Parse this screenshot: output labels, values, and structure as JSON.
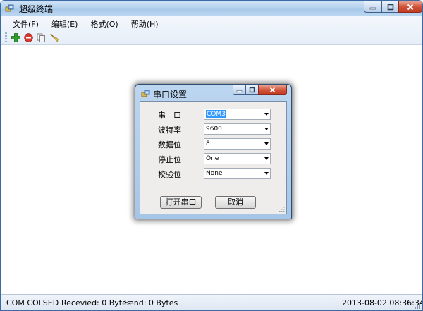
{
  "window": {
    "title": "超级终端"
  },
  "menu": [
    {
      "id": "file",
      "label": "文件(F)"
    },
    {
      "id": "edit",
      "label": "编辑(E)"
    },
    {
      "id": "format",
      "label": "格式(O)"
    },
    {
      "id": "help",
      "label": "帮助(H)"
    }
  ],
  "toolbar": [
    {
      "id": "add",
      "icon": "plus-icon"
    },
    {
      "id": "stop",
      "icon": "stop-icon"
    },
    {
      "id": "copy",
      "icon": "copy-icon"
    },
    {
      "id": "clear",
      "icon": "broom-icon"
    }
  ],
  "status": {
    "port_state": "COM COLSED",
    "received": "Recevied: 0 Bytes",
    "sent": "Send: 0 Bytes",
    "timestamp": "2013-08-02 08:36:34"
  },
  "dialog": {
    "title": "串口设置",
    "fields": [
      {
        "id": "port",
        "label": "串　口",
        "value": "COM3",
        "selected": true
      },
      {
        "id": "baud",
        "label": "波特率",
        "value": "9600",
        "selected": false
      },
      {
        "id": "databits",
        "label": "数据位",
        "value": "8",
        "selected": false
      },
      {
        "id": "stopbits",
        "label": "停止位",
        "value": "One",
        "selected": false
      },
      {
        "id": "parity",
        "label": "校验位",
        "value": "None",
        "selected": false
      }
    ],
    "open_button": "打开串口",
    "cancel_button": "取消"
  },
  "colors": {
    "titlebar": "#b6d3ef",
    "close_button": "#c23a22",
    "selection": "#3399ff"
  }
}
